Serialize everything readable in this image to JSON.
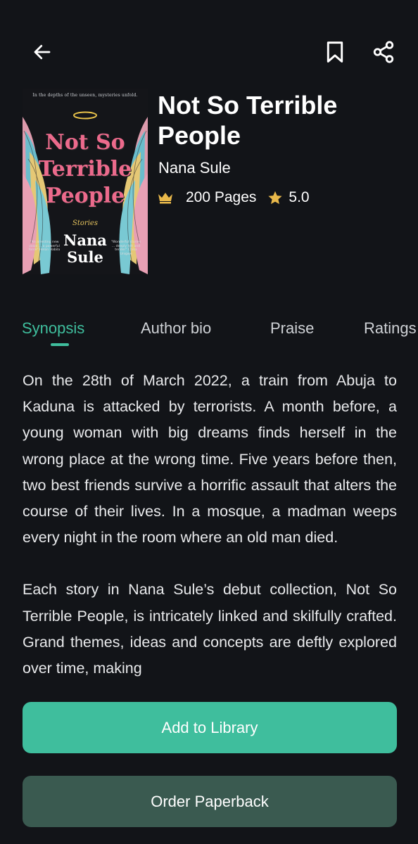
{
  "header": {
    "back_icon": "arrow-left-icon",
    "bookmark_icon": "bookmark-icon",
    "share_icon": "share-icon"
  },
  "book": {
    "title": "Not So Terrible People",
    "author": "Nana Sule",
    "pages": "200 Pages",
    "rating": "5.0",
    "pages_icon": "crown-icon",
    "rating_icon": "star-icon",
    "accent_color": "#e8b84a"
  },
  "cover": {
    "tagline": "In the depths of the unseen, mysteries unfold.",
    "title_lines": [
      "Not So",
      "Terrible",
      "People"
    ],
    "stories_label": "Stories",
    "author_lines": [
      "Nana",
      "Sule"
    ],
    "blurb_left": "\"An arresting new voice ... a powerful force\" Helon Habila",
    "blurb_right": "\"Wonderful stories ... deeply felt and tender\" Chika Unigwe"
  },
  "tabs": [
    {
      "label": "Synopsis",
      "active": true
    },
    {
      "label": "Author bio",
      "active": false
    },
    {
      "label": "Praise",
      "active": false
    },
    {
      "label": "Ratings",
      "active": false
    }
  ],
  "synopsis": {
    "paragraphs": [
      "On the 28th of March 2022, a train from Abuja to Kaduna is attacked by terrorists. A month before, a young woman with big dreams finds herself in the wrong place at the wrong time. Five years before then, two best friends survive a horrific assault that alters the course of their lives. In a mosque, a madman weeps every night in the room where an old man died.",
      "Each story in Nana Sule’s debut collection, Not So Terrible People, is intricately linked and skilfully crafted. Grand themes, ideas and concepts are deftly explored over time, making"
    ]
  },
  "actions": {
    "add_label": "Add to Library",
    "order_label": "Order Paperback"
  },
  "colors": {
    "background": "#121418",
    "accent": "#3fbe9d",
    "secondary_button": "#3a5a50"
  }
}
